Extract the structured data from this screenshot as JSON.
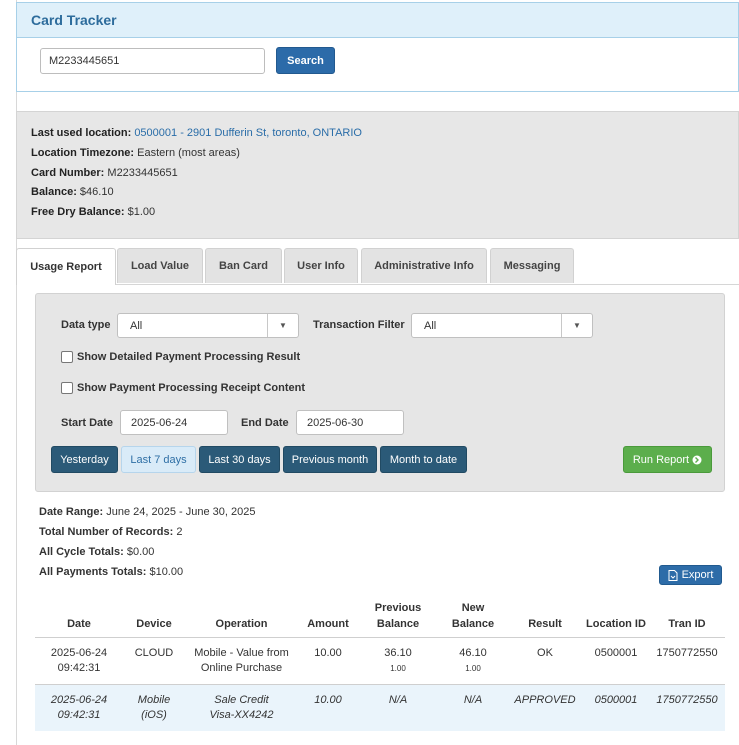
{
  "app": {
    "title": "Card Tracker"
  },
  "search": {
    "value": "M2233445651",
    "button": "Search"
  },
  "info": {
    "last_location_label": "Last used location:",
    "last_location_value": "0500001 - 2901 Dufferin St, toronto, ONTARIO",
    "timezone_label": "Location Timezone:",
    "timezone_value": "Eastern (most areas)",
    "card_label": "Card Number:",
    "card_value": "M2233445651",
    "balance_label": "Balance:",
    "balance_value": "$46.10",
    "free_label": "Free Dry Balance:",
    "free_value": "$1.00"
  },
  "tabs": [
    "Usage Report",
    "Load Value",
    "Ban Card",
    "User Info",
    "Administrative Info",
    "Messaging"
  ],
  "filters": {
    "data_type_label": "Data type",
    "data_type_value": "All",
    "transaction_filter_label": "Transaction Filter",
    "transaction_filter_value": "All",
    "chk_detailed": "Show Detailed Payment Processing Result",
    "chk_receipt": "Show Payment Processing Receipt Content",
    "start_label": "Start Date",
    "start_value": "2025-06-24",
    "end_label": "End Date",
    "end_value": "2025-06-30",
    "quick": [
      "Yesterday",
      "Last 7 days",
      "Last 30 days",
      "Previous month",
      "Month to date"
    ],
    "run_label": "Run Report"
  },
  "summary": {
    "range_label": "Date Range:",
    "range_value": "June 24, 2025 - June 30, 2025",
    "records_label": "Total Number of Records:",
    "records_value": "2",
    "cycle_label": "All Cycle Totals:",
    "cycle_value": "$0.00",
    "payments_label": "All Payments Totals:",
    "payments_value": "$10.00",
    "export_label": "Export"
  },
  "table": {
    "headers": [
      "Date",
      "Device",
      "Operation",
      "Amount",
      "Previous Balance",
      "New Balance",
      "Result",
      "Location ID",
      "Tran ID"
    ],
    "rows": [
      {
        "date": "2025-06-24",
        "time": "09:42:31",
        "device": "CLOUD",
        "device2": "",
        "op1": "Mobile - Value from",
        "op2": "Online Purchase",
        "amount": "10.00",
        "prev": "36.10",
        "prev_sub": "1.00",
        "new": "46.10",
        "new_sub": "1.00",
        "result": "OK",
        "location": "0500001",
        "tran": "1750772550"
      },
      {
        "date": "2025-06-24",
        "time": "09:42:31",
        "device": "Mobile",
        "device2": "(iOS)",
        "op1": "Sale Credit",
        "op2": "Visa-XX4242",
        "amount": "10.00",
        "prev": "N/A",
        "prev_sub": "",
        "new": "N/A",
        "new_sub": "",
        "result": "APPROVED",
        "location": "0500001",
        "tran": "1750772550"
      }
    ]
  },
  "colors": {
    "accent": "#2c6ba9",
    "header_bg": "#dff0fa",
    "run_green": "#5cae4c",
    "quick_dark": "#2b5a78"
  }
}
